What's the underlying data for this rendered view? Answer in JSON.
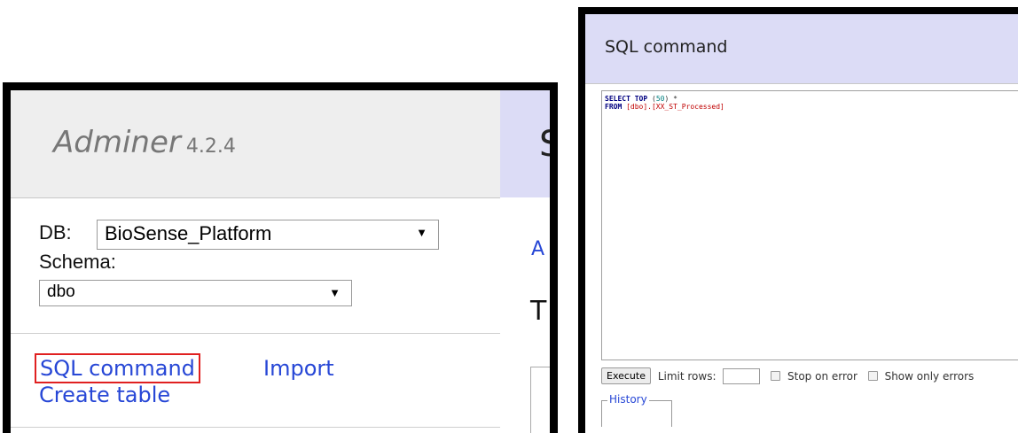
{
  "adminer": {
    "logo": "Adminer",
    "version": "4.2.4",
    "main_title_peek": "S",
    "db_label": "DB:",
    "db_selected": "BioSense_Platform",
    "schema_label": "Schema:",
    "schema_selected": "dbo",
    "links": {
      "sql_command": "SQL command",
      "import": "Import",
      "create_table": "Create table"
    },
    "content_peek_link": "A",
    "content_peek_title": "T"
  },
  "sql_panel": {
    "title": "SQL command",
    "query": {
      "line1": {
        "kw": "SELECT TOP",
        "open": " (",
        "num": "50",
        "close": ") *"
      },
      "line2": {
        "kw": "FROM",
        "ident": " [dbo].[XX_ST_Processed]"
      }
    },
    "execute_label": "Execute",
    "limit_label": "Limit rows:",
    "limit_value": "",
    "stop_on_error": "Stop on error",
    "show_only_errors": "Show only errors",
    "history_label": "History"
  }
}
